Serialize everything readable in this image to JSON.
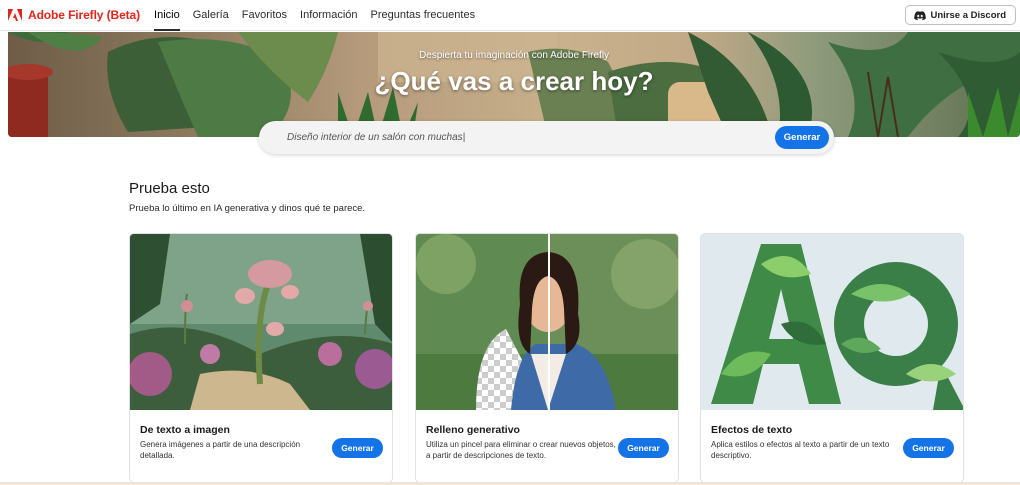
{
  "brand": {
    "name": "Adobe Firefly (Beta)",
    "logo_icon": "adobe-logo-icon",
    "color": "#e1251b"
  },
  "nav": {
    "items": [
      {
        "label": "Inicio",
        "active": true
      },
      {
        "label": "Galería"
      },
      {
        "label": "Favoritos"
      },
      {
        "label": "Información"
      },
      {
        "label": "Preguntas frecuentes"
      }
    ]
  },
  "discord": {
    "label": "Unirse a Discord",
    "icon": "discord-icon"
  },
  "hero": {
    "subtitle": "Despierta tu imaginación con Adobe Firefly",
    "title": "¿Qué vas a crear hoy?"
  },
  "search": {
    "value": "Diseño interior de un salón con muchas|",
    "button": "Generar"
  },
  "section": {
    "title": "Prueba esto",
    "description": "Prueba lo último en IA generativa y dinos qué te parece."
  },
  "cards": [
    {
      "title": "De texto a imagen",
      "description": "Genera imágenes a partir de una descripción detallada.",
      "button": "Generar"
    },
    {
      "title": "Relleno generativo",
      "description": "Utiliza un pincel para eliminar o crear nuevos objetos, a partir de descripciones de texto.",
      "button": "Generar"
    },
    {
      "title": "Efectos de texto",
      "description": "Aplica estilos o efectos al texto a partir de un texto descriptivo.",
      "button": "Generar"
    }
  ],
  "colors": {
    "accent": "#1473e6",
    "text": "#1a1a1a"
  }
}
